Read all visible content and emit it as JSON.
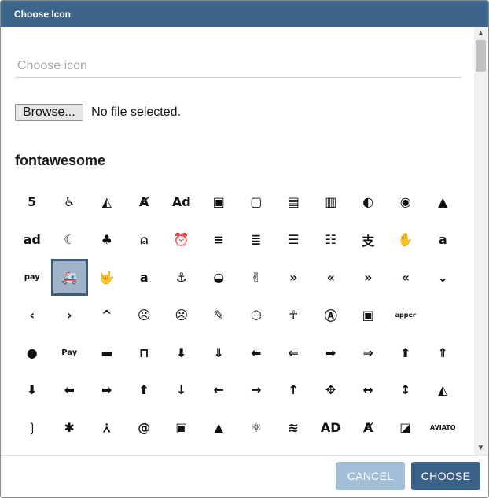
{
  "dialog": {
    "title": "Choose Icon"
  },
  "search": {
    "placeholder": "Choose icon",
    "value": ""
  },
  "file": {
    "browse_label": "Browse...",
    "status": "No file selected."
  },
  "section": {
    "title": "fontawesome"
  },
  "icons": [
    {
      "name": "500px-icon",
      "glyph": "5"
    },
    {
      "name": "accessible-icon",
      "glyph": "♿"
    },
    {
      "name": "accusoft-icon",
      "glyph": "◭"
    },
    {
      "name": "acquisitions-incorporated-icon",
      "glyph": "Ⱥ"
    },
    {
      "name": "ad-icon",
      "glyph": "Ad"
    },
    {
      "name": "address-book-icon",
      "glyph": "▣"
    },
    {
      "name": "address-book-outline-icon",
      "glyph": "▢"
    },
    {
      "name": "address-card-icon",
      "glyph": "▤"
    },
    {
      "name": "address-card-outline-icon",
      "glyph": "▥"
    },
    {
      "name": "adjust-icon",
      "glyph": "◐"
    },
    {
      "name": "adn-icon",
      "glyph": "◉"
    },
    {
      "name": "adobe-icon",
      "glyph": "▲"
    },
    {
      "name": "adversal-icon",
      "glyph": "ad"
    },
    {
      "name": "affiliatetheme-icon",
      "glyph": "☾"
    },
    {
      "name": "air-freshener-icon",
      "glyph": "♣"
    },
    {
      "name": "airbnb-icon",
      "glyph": "⍝"
    },
    {
      "name": "alarm-clock-icon",
      "glyph": "⏰"
    },
    {
      "name": "align-center-icon",
      "glyph": "≡"
    },
    {
      "name": "align-justify-icon",
      "glyph": "≣"
    },
    {
      "name": "align-left-icon",
      "glyph": "☰"
    },
    {
      "name": "align-right-icon",
      "glyph": "☷"
    },
    {
      "name": "alipay-icon",
      "glyph": "支"
    },
    {
      "name": "allergies-icon",
      "glyph": "✋"
    },
    {
      "name": "amazon-icon",
      "glyph": "a"
    },
    {
      "name": "amazon-pay-icon",
      "glyph": "pay"
    },
    {
      "name": "ambulance-icon",
      "glyph": "🚑"
    },
    {
      "name": "american-sign-language-interpreting-icon",
      "glyph": "🤟"
    },
    {
      "name": "amilia-icon",
      "glyph": "a"
    },
    {
      "name": "anchor-icon",
      "glyph": "⚓"
    },
    {
      "name": "android-icon",
      "glyph": "◒"
    },
    {
      "name": "angellist-icon",
      "glyph": "✌"
    },
    {
      "name": "angle-double-down-icon",
      "glyph": "»"
    },
    {
      "name": "angle-double-left-icon",
      "glyph": "«"
    },
    {
      "name": "angle-double-right-icon",
      "glyph": "»"
    },
    {
      "name": "angle-double-up-icon",
      "glyph": "«"
    },
    {
      "name": "angle-down-icon",
      "glyph": "⌄"
    },
    {
      "name": "angle-left-icon",
      "glyph": "‹"
    },
    {
      "name": "angle-right-icon",
      "glyph": "›"
    },
    {
      "name": "angle-up-icon",
      "glyph": "^"
    },
    {
      "name": "angry-icon",
      "glyph": "☹"
    },
    {
      "name": "angry-outline-icon",
      "glyph": "☹"
    },
    {
      "name": "angrycreative-icon",
      "glyph": "✎"
    },
    {
      "name": "angular-icon",
      "glyph": "⬡"
    },
    {
      "name": "ankh-icon",
      "glyph": "☥"
    },
    {
      "name": "app-store-icon",
      "glyph": "Ⓐ"
    },
    {
      "name": "app-store-ios-icon",
      "glyph": "▣"
    },
    {
      "name": "apper-icon",
      "glyph": "apper"
    },
    {
      "name": "apple-icon",
      "glyph": ""
    },
    {
      "name": "apple-alt-icon",
      "glyph": "●"
    },
    {
      "name": "apple-pay-icon",
      "glyph": "Pay"
    },
    {
      "name": "archive-icon",
      "glyph": "▬"
    },
    {
      "name": "archway-icon",
      "glyph": "⊓"
    },
    {
      "name": "arrow-alt-circle-down-icon",
      "glyph": "⬇"
    },
    {
      "name": "arrow-alt-circle-down-outline-icon",
      "glyph": "⇓"
    },
    {
      "name": "arrow-alt-circle-left-icon",
      "glyph": "⬅"
    },
    {
      "name": "arrow-alt-circle-left-outline-icon",
      "glyph": "⇐"
    },
    {
      "name": "arrow-alt-circle-right-icon",
      "glyph": "➡"
    },
    {
      "name": "arrow-alt-circle-right-outline-icon",
      "glyph": "⇒"
    },
    {
      "name": "arrow-alt-circle-up-icon",
      "glyph": "⬆"
    },
    {
      "name": "arrow-alt-circle-up-outline-icon",
      "glyph": "⇑"
    },
    {
      "name": "arrow-circle-down-icon",
      "glyph": "⬇"
    },
    {
      "name": "arrow-circle-left-icon",
      "glyph": "⬅"
    },
    {
      "name": "arrow-circle-right-icon",
      "glyph": "➡"
    },
    {
      "name": "arrow-circle-up-icon",
      "glyph": "⬆"
    },
    {
      "name": "arrow-down-icon",
      "glyph": "↓"
    },
    {
      "name": "arrow-left-icon",
      "glyph": "←"
    },
    {
      "name": "arrow-right-icon",
      "glyph": "→"
    },
    {
      "name": "arrow-up-icon",
      "glyph": "↑"
    },
    {
      "name": "arrows-alt-icon",
      "glyph": "✥"
    },
    {
      "name": "arrows-alt-h-icon",
      "glyph": "↔"
    },
    {
      "name": "arrows-alt-v-icon",
      "glyph": "↕"
    },
    {
      "name": "artstation-icon",
      "glyph": "◭"
    },
    {
      "name": "assistive-listening-systems-icon",
      "glyph": "❳"
    },
    {
      "name": "asterisk-icon",
      "glyph": "✱"
    },
    {
      "name": "asymmetrik-icon",
      "glyph": "⩑"
    },
    {
      "name": "at-icon",
      "glyph": "@"
    },
    {
      "name": "atlas-icon",
      "glyph": "▣"
    },
    {
      "name": "atlassian-icon",
      "glyph": "▲"
    },
    {
      "name": "atom-icon",
      "glyph": "⚛"
    },
    {
      "name": "audible-icon",
      "glyph": "≋"
    },
    {
      "name": "audio-description-icon",
      "glyph": "AD"
    },
    {
      "name": "autoprefixer-icon",
      "glyph": "Ⱥ"
    },
    {
      "name": "avianex-icon",
      "glyph": "◪"
    },
    {
      "name": "aviato-icon",
      "glyph": "AVIATO"
    }
  ],
  "selected_icon_index": 25,
  "footer": {
    "cancel_label": "CANCEL",
    "choose_label": "CHOOSE"
  },
  "colors": {
    "titlebar": "#3d6589",
    "primary_button": "#3b6389",
    "disabled_button": "#a3bfd7",
    "selected_cell": "#9eb2c8"
  }
}
